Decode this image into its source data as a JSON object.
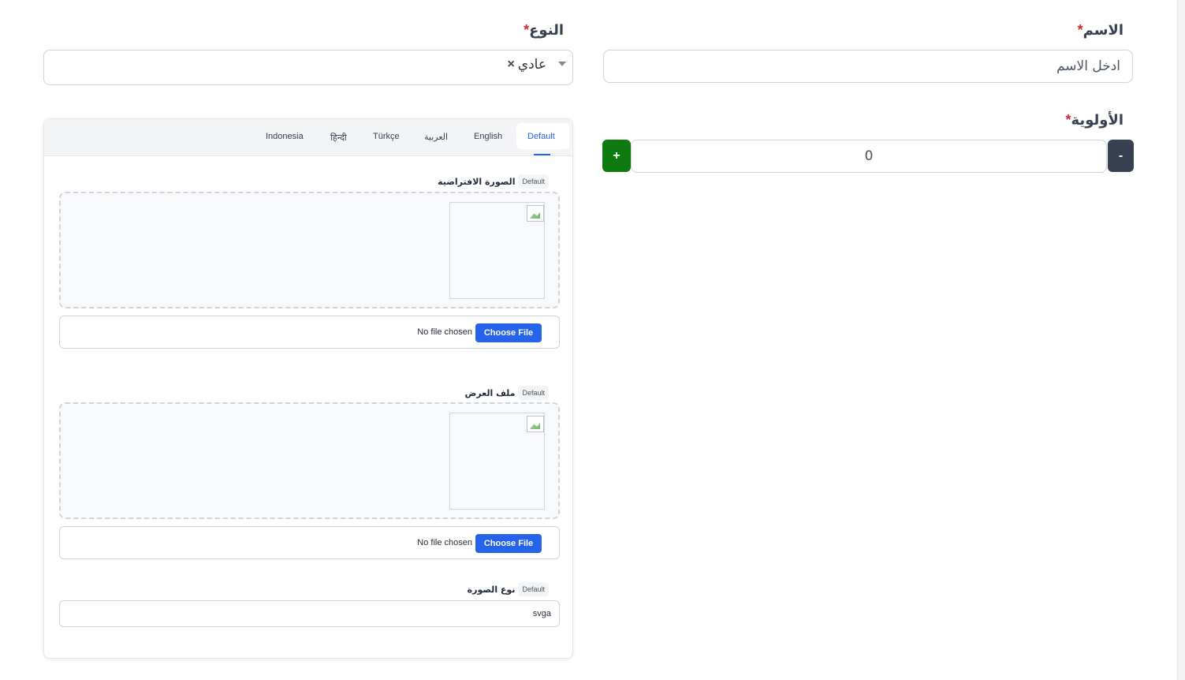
{
  "form": {
    "name": {
      "label": "الاسم",
      "required_mark": "*",
      "placeholder": "ادخل الاسم",
      "value": ""
    },
    "type": {
      "label": "النوع",
      "required_mark": "*",
      "selected": "عادي",
      "remove_glyph": "×"
    },
    "priority": {
      "label": "الأولوية",
      "required_mark": "*",
      "value": "0",
      "plus_label": "+",
      "minus_label": "-"
    }
  },
  "language_tabs": {
    "active": "Default",
    "tabs": [
      "Default",
      "English",
      "العربية",
      "Türkçe",
      "हिन्दी",
      "Indonesia"
    ]
  },
  "default_image": {
    "label": "الصورة الافتراضية",
    "badge": "Default",
    "file_button": "Choose File",
    "file_status": "No file chosen"
  },
  "display_file": {
    "label": "ملف العرض",
    "badge": "Default",
    "file_button": "Choose File",
    "file_status": "No file chosen"
  },
  "image_type": {
    "label": "نوع الصورة",
    "badge": "Default",
    "value": "svga"
  },
  "colors": {
    "plus_button": "#0f7a0f",
    "minus_button": "#374151",
    "primary": "#2563eb",
    "required": "#dc2626"
  },
  "icons": {
    "type_remove": "close-icon",
    "type_caret": "chevron-down-icon",
    "preview_placeholder": "broken-image-icon"
  }
}
